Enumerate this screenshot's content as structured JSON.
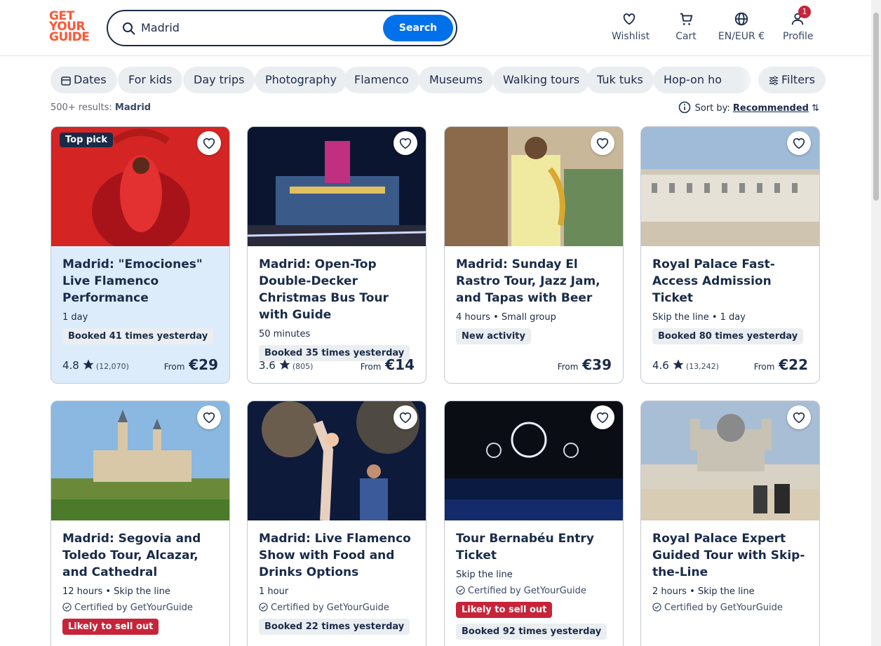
{
  "logo": {
    "line1": "GET",
    "line2": "YOUR",
    "line3": "GUIDE"
  },
  "search": {
    "value": "Madrid",
    "button": "Search",
    "icon": "search-icon"
  },
  "nav": {
    "wishlist": "Wishlist",
    "cart": "Cart",
    "lang": "EN/EUR €",
    "profile": "Profile",
    "profile_badge": "1"
  },
  "chips": [
    "Dates",
    "For kids",
    "Day trips",
    "Photography",
    "Flamenco",
    "Museums",
    "Walking tours",
    "Tuk tuks",
    "Hop-on ho"
  ],
  "filters": "Filters",
  "results": {
    "count": "500+ results:",
    "query": "Madrid"
  },
  "sort": {
    "label": "Sort by:",
    "value": "Recommended"
  },
  "colors": {
    "brand": "#ff5533",
    "accent": "#0071eb",
    "navy": "#1a2b49",
    "danger": "#c7243a",
    "highlight": "#ddecfb"
  },
  "cards": [
    {
      "title": "Madrid: \"Emociones\" Live Flamenco Performance",
      "meta": "1 day",
      "badge": "Top pick",
      "pill": "Booked 41 times yesterday",
      "rating": "4.8",
      "reviews": "(12,070)",
      "from": "From",
      "price": "€29"
    },
    {
      "title": "Madrid: Open-Top Double-Decker Christmas Bus Tour with Guide",
      "meta": "50 minutes",
      "pill": "Booked 35 times yesterday",
      "rating": "3.6",
      "reviews": "(805)",
      "from": "From",
      "price": "€14"
    },
    {
      "title": "Madrid: Sunday El Rastro Tour, Jazz Jam, and Tapas with Beer",
      "meta": "4 hours • Small group",
      "pill": "New activity",
      "from": "From",
      "price": "€39"
    },
    {
      "title": "Royal Palace Fast-Access Admission Ticket",
      "meta": "Skip the line • 1 day",
      "pill": "Booked 80 times yesterday",
      "rating": "4.6",
      "reviews": "(13,242)",
      "from": "From",
      "price": "€22"
    },
    {
      "title": "Madrid: Segovia and Toledo Tour, Alcazar, and Cathedral",
      "meta": "12 hours • Skip the line",
      "cert": "Certified by GetYourGuide",
      "pill": "Likely to sell out"
    },
    {
      "title": "Madrid: Live Flamenco Show with Food and Drinks Options",
      "meta": "1 hour",
      "cert": "Certified by GetYourGuide",
      "pill": "Booked 22 times yesterday"
    },
    {
      "title": "Tour Bernabéu Entry Ticket",
      "meta": "Skip the line",
      "cert": "Certified by GetYourGuide",
      "pill": "Likely to sell out",
      "pill2": "Booked 92 times yesterday"
    },
    {
      "title": "Royal Palace Expert Guided Tour with Skip-the-Line",
      "meta": "2 hours • Skip the line",
      "cert": "Certified by GetYourGuide"
    }
  ]
}
